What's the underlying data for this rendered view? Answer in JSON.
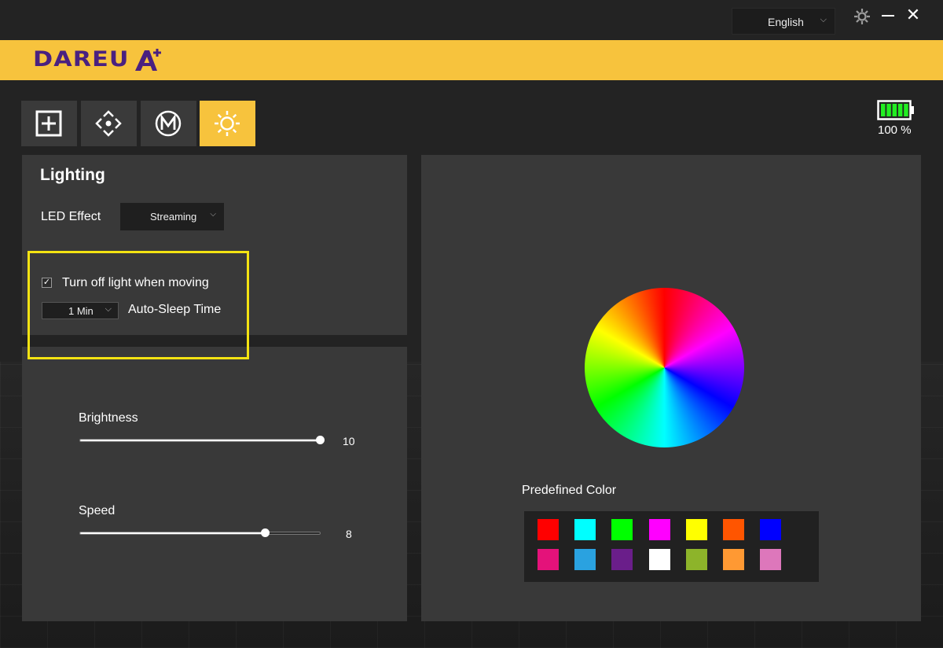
{
  "titlebar": {
    "language": "English",
    "icons": [
      "gear-icon",
      "minimize-icon",
      "close-icon"
    ],
    "close_glyph": "✕"
  },
  "brand": {
    "logo_text": "DAREU",
    "logo_color": "#4a2180",
    "bar_color": "#f7c33d"
  },
  "tabs": [
    {
      "icon": "plus-square-icon",
      "active": false
    },
    {
      "icon": "direction-pad-icon",
      "active": false
    },
    {
      "icon": "macro-m-icon",
      "active": false
    },
    {
      "icon": "sun-icon",
      "active": true
    }
  ],
  "battery": {
    "percent_label": "100 %",
    "level": 1.0,
    "color": "#22ee22"
  },
  "lighting": {
    "title": "Lighting",
    "led_effect_label": "LED Effect",
    "led_effect_value": "Streaming",
    "turn_off_checked": true,
    "turn_off_label": "Turn off light when moving",
    "sleep_value": "1 Min",
    "sleep_label": "Auto-Sleep Time"
  },
  "sliders": {
    "brightness": {
      "label": "Brightness",
      "value": "10",
      "fraction": 1.0
    },
    "speed": {
      "label": "Speed",
      "value": "8",
      "fraction": 0.77
    }
  },
  "color": {
    "predefined_label": "Predefined Color",
    "swatches": [
      [
        "#ff0000",
        "#00ffff",
        "#00ff00",
        "#ff00ff",
        "#ffff00",
        "#ff5500",
        "#0000ff"
      ],
      [
        "#e4127a",
        "#2aa2e0",
        "#6a1e8a",
        "#ffffff",
        "#8db42a",
        "#ff9933",
        "#dd77bb"
      ]
    ]
  },
  "highlight_color": "#f4e312"
}
